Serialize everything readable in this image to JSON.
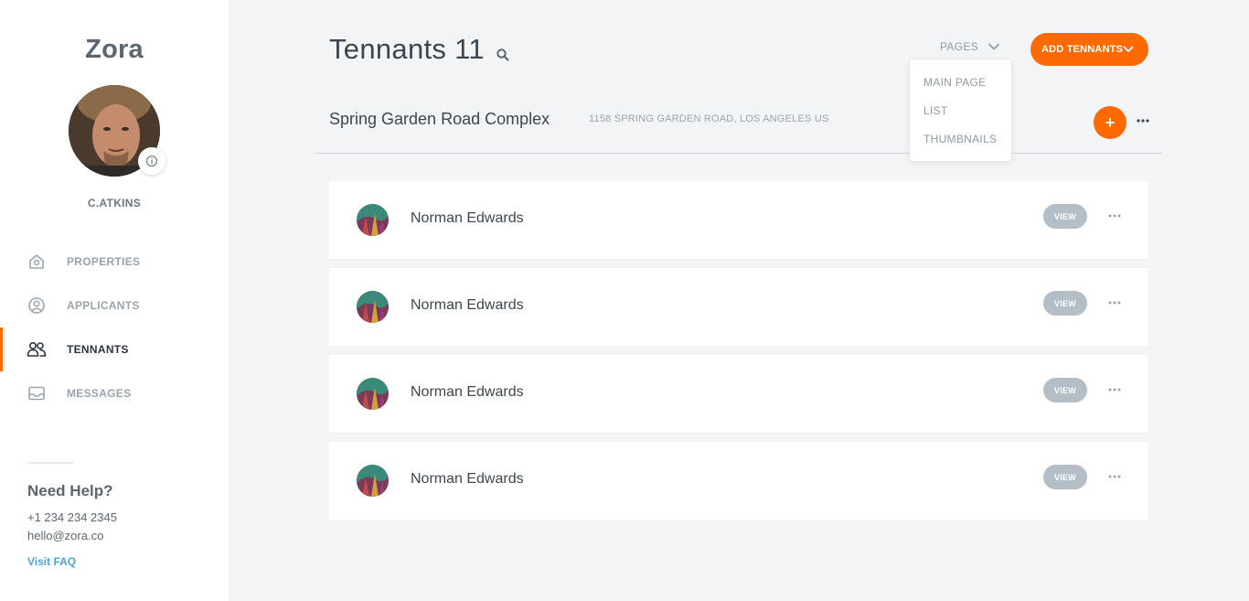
{
  "sidebar": {
    "brand": "Zora",
    "username": "C.ATKINS",
    "nav": [
      {
        "label": "PROPERTIES",
        "icon": "home-icon",
        "active": false
      },
      {
        "label": "APPLICANTS",
        "icon": "user-circle-icon",
        "active": false
      },
      {
        "label": "TENNANTS",
        "icon": "users-icon",
        "active": true
      },
      {
        "label": "MESSAGES",
        "icon": "inbox-icon",
        "active": false
      }
    ],
    "help": {
      "title": "Need Help?",
      "phone": "+1 234 234 2345",
      "email": "hello@zora.co",
      "faq": "Visit FAQ"
    }
  },
  "header": {
    "title": "Tennants 11",
    "pages_label": "PAGES",
    "add_label": "ADD TENNANTS",
    "dropdown": [
      "MAIN PAGE",
      "LIST",
      "THUMBNAILS"
    ]
  },
  "complex": {
    "name": "Spring Garden Road Complex",
    "address": "1158 SPRING GARDEN ROAD, LOS ANGELES US",
    "add_label": "+"
  },
  "tenants": [
    {
      "name": "Norman Edwards",
      "view_label": "VIEW"
    },
    {
      "name": "Norman Edwards",
      "view_label": "VIEW"
    },
    {
      "name": "Norman Edwards",
      "view_label": "VIEW"
    },
    {
      "name": "Norman Edwards",
      "view_label": "VIEW"
    }
  ],
  "colors": {
    "accent": "#ff6a00",
    "link": "#4aa3df",
    "muted": "#9aa4ae",
    "view_button": "#b4bec6"
  }
}
